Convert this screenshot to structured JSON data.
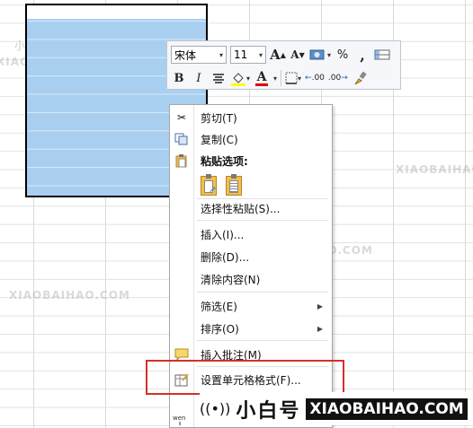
{
  "toolbar": {
    "font_name": "宋体",
    "font_size": "11",
    "grow_font": "A",
    "shrink_font": "A",
    "percent": "%",
    "comma": ",",
    "bold": "B",
    "italic": "I",
    "font_color_letter": "A",
    "dec_increase": ".00",
    "dec_decrease": ".00"
  },
  "menu": {
    "cut": "剪切(T)",
    "copy": "复制(C)",
    "paste_options": "粘贴选项:",
    "paste_special": "选择性粘贴(S)...",
    "insert": "插入(I)...",
    "delete": "删除(D)...",
    "clear_contents": "清除内容(N)",
    "filter": "筛选(E)",
    "sort": "排序(O)",
    "insert_comment": "插入批注(M)",
    "format_cells": "设置单元格格式(F)..."
  },
  "watermark": {
    "brand_cn": "小白号",
    "brand_en": "XIAOBAIHAO.COM"
  }
}
